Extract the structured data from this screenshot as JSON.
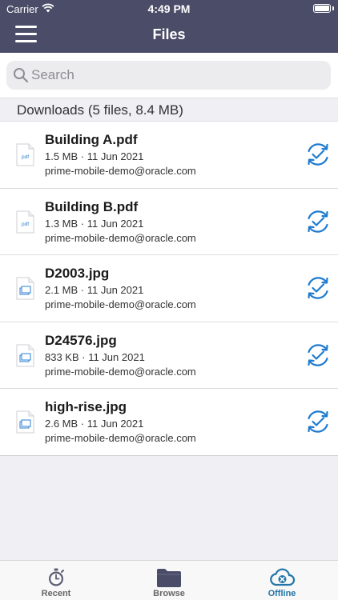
{
  "status_bar": {
    "carrier": "Carrier",
    "time": "4:49 PM"
  },
  "nav": {
    "title": "Files"
  },
  "search": {
    "placeholder": "Search"
  },
  "section": {
    "title": "Downloads (5 files, 8.4 MB)"
  },
  "files": [
    {
      "name": "Building A.pdf",
      "meta": "1.5 MB · 11 Jun 2021",
      "owner": "prime-mobile-demo@oracle.com",
      "type_label": "pdf"
    },
    {
      "name": "Building B.pdf",
      "meta": "1.3 MB · 11 Jun 2021",
      "owner": "prime-mobile-demo@oracle.com",
      "type_label": "pdf"
    },
    {
      "name": "D2003.jpg",
      "meta": "2.1 MB · 11 Jun 2021",
      "owner": "prime-mobile-demo@oracle.com",
      "type_label": ""
    },
    {
      "name": "D24576.jpg",
      "meta": "833 KB · 11 Jun 2021",
      "owner": "prime-mobile-demo@oracle.com",
      "type_label": ""
    },
    {
      "name": "high-rise.jpg",
      "meta": "2.6 MB · 11 Jun 2021",
      "owner": "prime-mobile-demo@oracle.com",
      "type_label": ""
    }
  ],
  "tabs": [
    {
      "label": "Recent",
      "icon": "stopwatch-icon",
      "active": false
    },
    {
      "label": "Browse",
      "icon": "folder-icon",
      "active": false
    },
    {
      "label": "Offline",
      "icon": "cloud-offline-icon",
      "active": true
    }
  ],
  "colors": {
    "header": "#4a4c68",
    "accent": "#2376a8",
    "sync": "#1f7bd0"
  }
}
